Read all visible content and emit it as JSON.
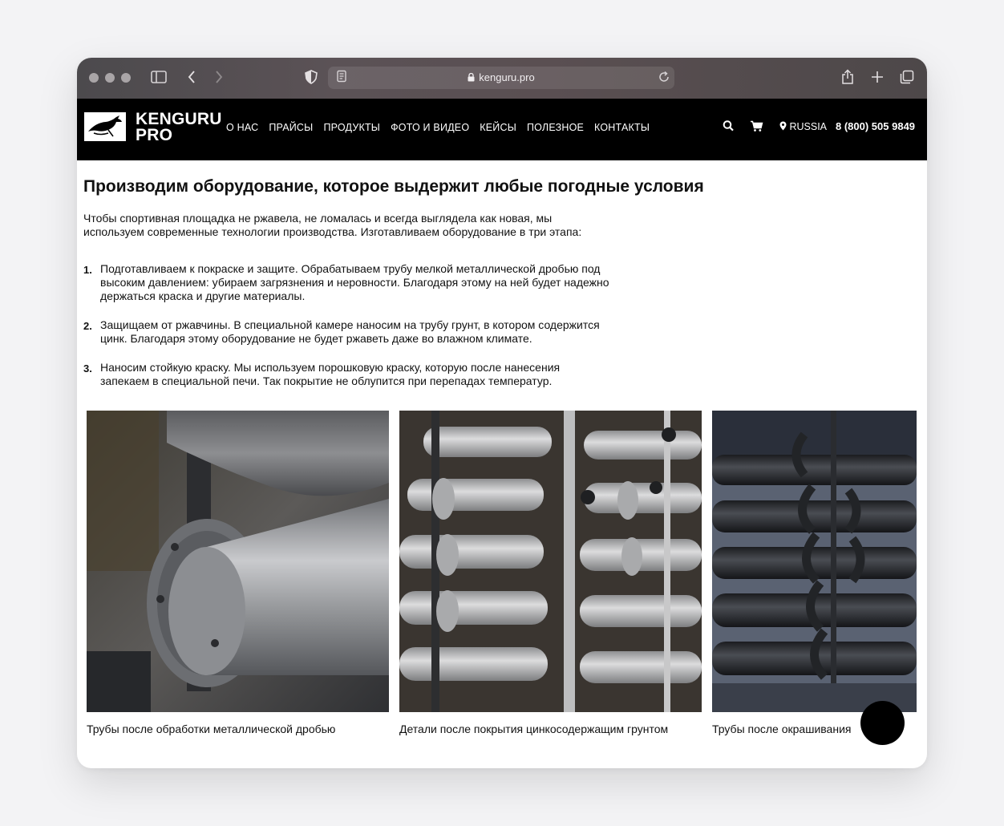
{
  "browser": {
    "url": "kenguru.pro"
  },
  "header": {
    "logo_line1": "KENGURU",
    "logo_line2": "PRO",
    "nav": [
      "О НАС",
      "ПРАЙСЫ",
      "ПРОДУКТЫ",
      "ФОТО И ВИДЕО",
      "КЕЙСЫ",
      "ПОЛЕЗНОЕ",
      "КОНТАКТЫ"
    ],
    "region": "RUSSIA",
    "phone": "8 (800) 505 9849"
  },
  "main": {
    "title": "Производим оборудование, которое выдержит любые погодные условия",
    "intro_line1": "Чтобы спортивная площадка не ржавела, не ломалась и всегда выглядела как новая, мы",
    "intro_line2": "используем современные технологии производства. Изготавливаем оборудование в три этапа:",
    "steps": [
      {
        "num": "1.",
        "line1": "Подготавливаем к покраске и защите. Обрабатываем трубу мелкой металлической дробью под",
        "line2": "высоким давлением: убираем загрязнения и неровности. Благодаря этому на ней будет надежно",
        "line3": "держаться краска и другие материалы."
      },
      {
        "num": "2.",
        "line1": "Защищаем от ржавчины. В специальной камере наносим на трубу грунт, в котором содержится",
        "line2": "цинк. Благодаря этому оборудование не будет ржаветь даже во влажном климате."
      },
      {
        "num": "3.",
        "line1": "Наносим стойкую краску. Мы используем порошковую краску, которую после нанесения",
        "line2": "запекаем в специальной печи. Так покрытие не облупится при перепадах температур."
      }
    ],
    "captions": [
      "Трубы после обработки металлической дробью",
      "Детали после покрытия цинкосодержащим грунтом",
      "Трубы после окрашивания"
    ]
  }
}
